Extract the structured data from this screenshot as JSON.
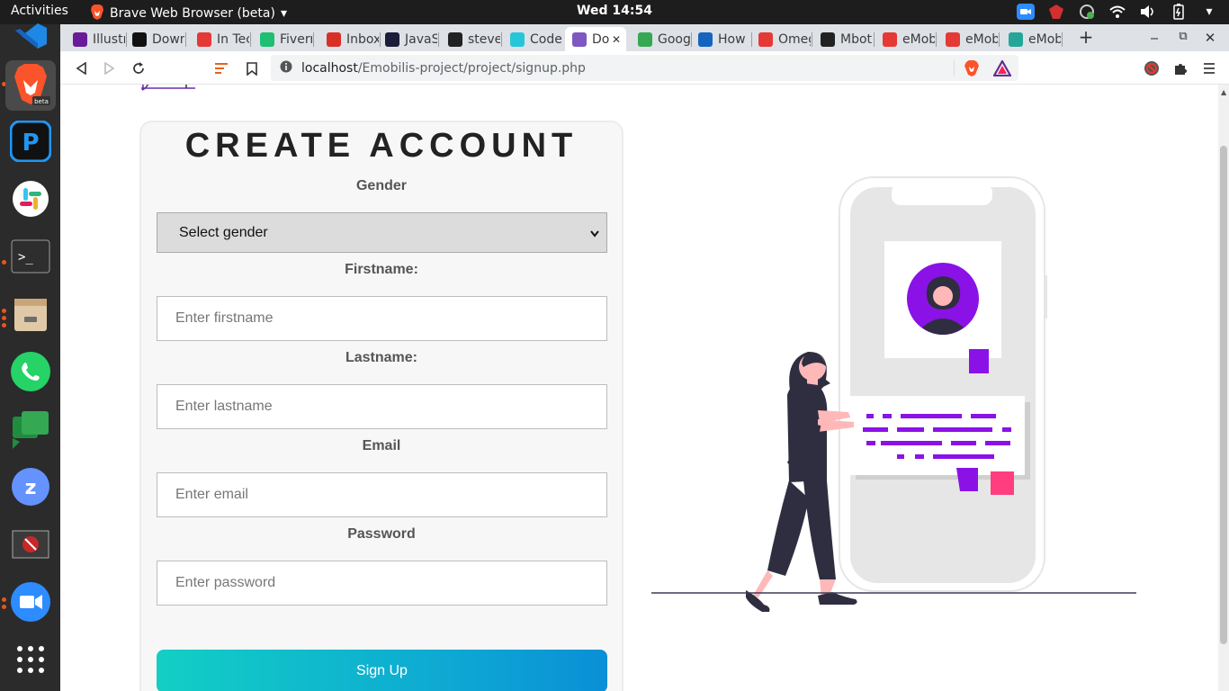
{
  "system": {
    "activities": "Activities",
    "app_name": "Brave Web Browser (beta)",
    "clock": "Wed 14:54"
  },
  "tabs": [
    {
      "label": "Illustr",
      "color": "#6a1b9a"
    },
    {
      "label": "Down",
      "color": "#111111"
    },
    {
      "label": "In Tec",
      "color": "#e53935"
    },
    {
      "label": "Fiverr",
      "color": "#1dbf73"
    },
    {
      "label": "Inbox",
      "color": "#d93025"
    },
    {
      "label": "JavaS",
      "color": "#1b1b3a"
    },
    {
      "label": "steve",
      "color": "#222222"
    },
    {
      "label": "Code",
      "color": "#26c6da"
    },
    {
      "label": "Do",
      "color": "#7e57c2"
    },
    {
      "label": "Goog",
      "color": "#34a853"
    },
    {
      "label": "How",
      "color": "#1565c0"
    },
    {
      "label": "Omeg",
      "color": "#e53935"
    },
    {
      "label": "Mbot",
      "color": "#222222"
    },
    {
      "label": "eMob",
      "color": "#e53935"
    },
    {
      "label": "eMob",
      "color": "#e53935"
    },
    {
      "label": "eMob",
      "color": "#26a69a"
    }
  ],
  "address": {
    "host": "localhost",
    "path": "/Emobilis-project/project/signup.php"
  },
  "form": {
    "title": "CREATE ACCOUNT",
    "gender_label": "Gender",
    "gender_value": "Select gender",
    "firstname_label": "Firstname:",
    "firstname_placeholder": "Enter firstname",
    "lastname_label": "Lastname:",
    "lastname_placeholder": "Enter lastname",
    "email_label": "Email",
    "email_placeholder": "Enter email",
    "password_label": "Password",
    "password_placeholder": "Enter password",
    "submit_label": "Sign Up"
  },
  "colors": {
    "accent_purple": "#8a12e6",
    "accent_pink": "#ff3d7f",
    "button_gradient_start": "#12cfc4",
    "button_gradient_end": "#0a8fd6"
  }
}
